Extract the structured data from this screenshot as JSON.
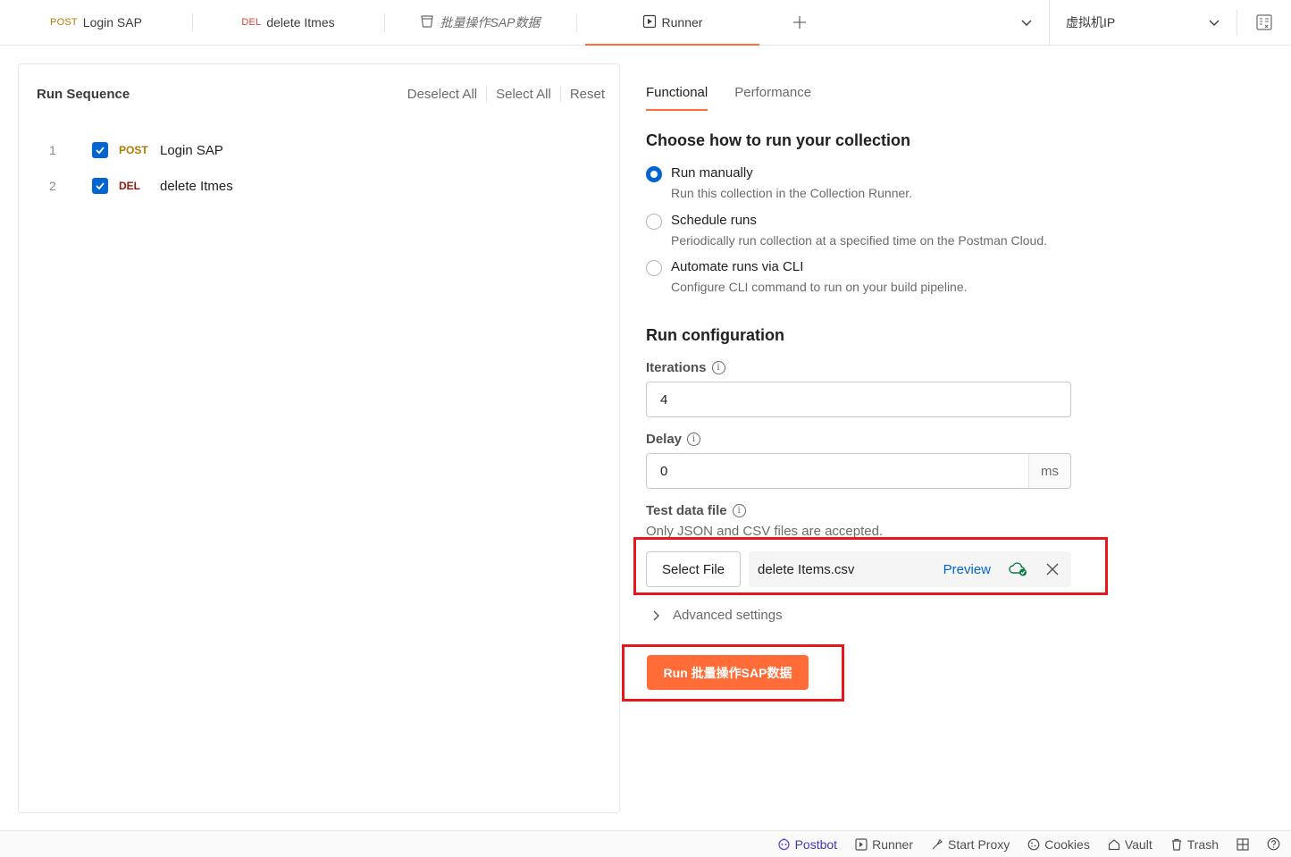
{
  "tabs": [
    {
      "method": "POST",
      "method_color": "#ad7a03",
      "label": "Login SAP"
    },
    {
      "method": "DEL",
      "method_color": "#8e1a10",
      "label": "delete Itmes"
    },
    {
      "label": "批量操作SAP数据"
    },
    {
      "label": "Runner",
      "active": true
    }
  ],
  "environment": {
    "label": "虚拟机IP"
  },
  "run_sequence": {
    "title": "Run Sequence",
    "deselect_all": "Deselect All",
    "select_all": "Select All",
    "reset": "Reset",
    "items": [
      {
        "index": "1",
        "method": "POST",
        "name": "Login SAP",
        "checked": true
      },
      {
        "index": "2",
        "method": "DEL",
        "name": "delete Itmes",
        "checked": true
      }
    ]
  },
  "subtabs": {
    "functional": "Functional",
    "performance": "Performance"
  },
  "run_mode": {
    "heading": "Choose how to run your collection",
    "options": [
      {
        "title": "Run manually",
        "desc": "Run this collection in the Collection Runner.",
        "selected": true
      },
      {
        "title": "Schedule runs",
        "desc": "Periodically run collection at a specified time on the Postman Cloud.",
        "selected": false
      },
      {
        "title": "Automate runs via CLI",
        "desc": "Configure CLI command to run on your build pipeline.",
        "selected": false
      }
    ]
  },
  "config": {
    "heading": "Run configuration",
    "iterations_label": "Iterations",
    "iterations_value": "4",
    "delay_label": "Delay",
    "delay_value": "0",
    "delay_unit": "ms",
    "test_data_label": "Test data file",
    "test_data_hint": "Only JSON and CSV files are accepted.",
    "select_file": "Select File",
    "file_name": "delete Items.csv",
    "preview": "Preview",
    "advanced": "Advanced settings",
    "run_button": "Run 批量操作SAP数据"
  },
  "footer": {
    "postbot": "Postbot",
    "runner": "Runner",
    "start_proxy": "Start Proxy",
    "cookies": "Cookies",
    "vault": "Vault",
    "trash": "Trash"
  },
  "colors": {
    "accent": "#ff6c37",
    "checkbox": "#0265d2",
    "highlight": "#e8171c"
  }
}
